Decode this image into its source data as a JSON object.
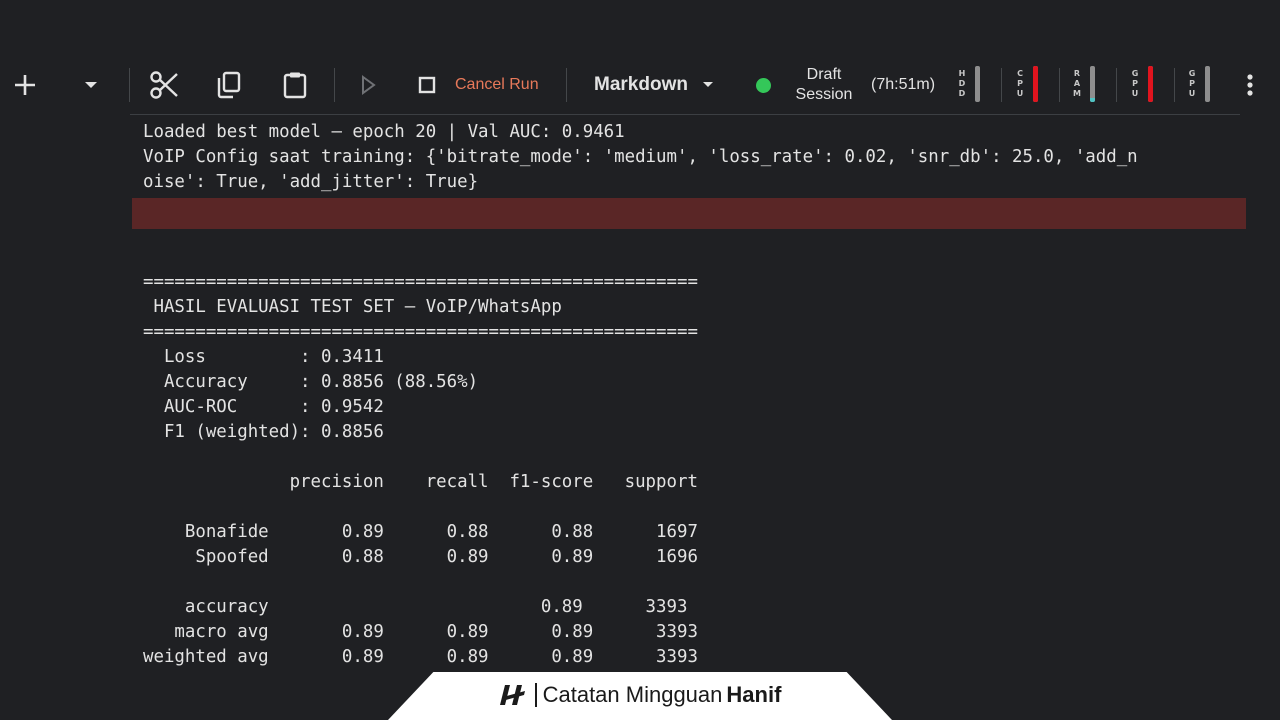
{
  "toolbar": {
    "add_icon": "plus-icon",
    "add_menu_icon": "chevron-down-icon",
    "cut_icon": "scissors-icon",
    "copy_icon": "copy-icon",
    "paste_icon": "clipboard-icon",
    "run_icon": "play-icon",
    "stop_icon": "stop-icon",
    "cancel_label": "Cancel Run",
    "cell_type": "Markdown",
    "session_status_line1": "Draft",
    "session_status_line2": "Session",
    "session_time": "(7h:51m)",
    "more_icon": "more-vert-icon",
    "colors": {
      "cancel": "#e8795a",
      "session_dot": "#34c759",
      "high_usage": "#e0141e",
      "low_usage": "#4fc3c3"
    },
    "meters": [
      {
        "label": [
          "H",
          "D",
          "D"
        ],
        "fill": 0.0
      },
      {
        "label": [
          "C",
          "P",
          "U"
        ],
        "fill": 1.0,
        "color": "#e0141e"
      },
      {
        "label": [
          "R",
          "A",
          "M"
        ],
        "fill": 0.1,
        "color": "#4fc3c3"
      },
      {
        "label": [
          "G",
          "P",
          "U"
        ],
        "fill": 1.0,
        "color": "#e0141e"
      },
      {
        "label": [
          "G",
          "P",
          "U"
        ],
        "fill": 0.0
      }
    ]
  },
  "output": {
    "lines": [
      "Loaded best model — epoch 20 | Val AUC: 0.9461",
      "VoIP Config saat training: {'bitrate_mode': 'medium', 'loss_rate': 0.02, 'snr_db': 25.0, 'add_n",
      "oise': True, 'add_jitter': True}",
      "",
      "",
      "",
      "=====================================================",
      " HASIL EVALUASI TEST SET — VoIP/WhatsApp",
      "=====================================================",
      "  Loss         : 0.3411",
      "  Accuracy     : 0.8856 (88.56%)",
      "  AUC-ROC      : 0.9542",
      "  F1 (weighted): 0.8856",
      "",
      "              precision    recall  f1-score   support",
      "",
      "    Bonafide       0.89      0.88      0.88      1697",
      "     Spoofed       0.88      0.89      0.89      1696",
      "",
      "    accuracy                          0.89      3393",
      "   macro avg       0.89      0.89      0.89      3393",
      "weighted avg       0.89      0.89      0.89      3393"
    ]
  },
  "footer": {
    "logo_icon": "hanif-logo-icon",
    "text": "Catatan Mingguan",
    "bold": "Hanif"
  }
}
